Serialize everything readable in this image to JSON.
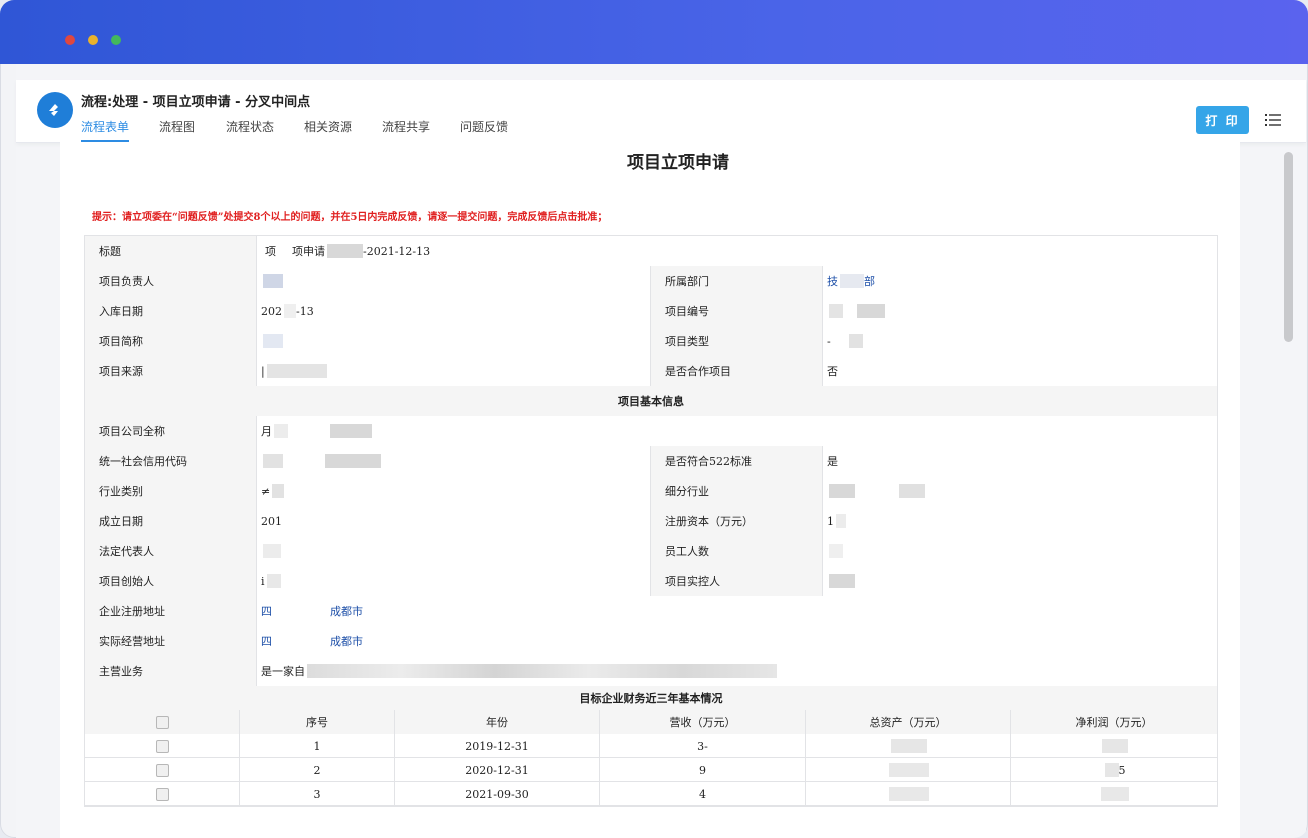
{
  "window": {
    "title": "流程:处理 - 项目立项申请 - 分叉中间点",
    "tabs": [
      "流程表单",
      "流程图",
      "流程状态",
      "相关资源",
      "流程共享",
      "问题反馈"
    ],
    "print_label": "打 印"
  },
  "document": {
    "title": "项目立项申请",
    "hint": "提示：请立项委在“问题反馈”处提交8个以上的问题，并在5日内完成反馈，请逐一提交问题，完成反馈后点击批准；",
    "fields": {
      "title_label": "标题",
      "title_value_a": "项",
      "title_value_b": "项申请",
      "title_value_c": "-2021-12-13",
      "owner_label": "项目负责人",
      "dept_label": "所属部门",
      "dept_value": "技",
      "dept_value_b": "部",
      "date_label": "入库日期",
      "date_value_a": "202",
      "date_value_b": "-13",
      "code_label": "项目编号",
      "short_label": "项目简称",
      "type_label": "项目类型",
      "type_value": "-",
      "source_label": "项目来源",
      "source_value": "|",
      "coop_label": "是否合作项目",
      "coop_value": "否"
    },
    "section_basic": "项目基本信息",
    "basic": {
      "company_label": "项目公司全称",
      "company_value": "月",
      "credit_label": "统一社会信用代码",
      "std_label": "是否符合522标准",
      "std_value": "是",
      "industry_label": "行业类别",
      "industry_value": "≠",
      "sub_industry_label": "细分行业",
      "founded_label": "成立日期",
      "founded_value": "201",
      "capital_label": "注册资本（万元）",
      "capital_value": "1",
      "legal_label": "法定代表人",
      "staff_label": "员工人数",
      "founder_label": "项目创始人",
      "founder_value": "i",
      "controller_label": "项目实控人",
      "reg_addr_label": "企业注册地址",
      "reg_addr_a": "四",
      "reg_addr_b": "成都市",
      "op_addr_label": "实际经营地址",
      "op_addr_a": "四",
      "op_addr_b": "成都市",
      "business_label": "主营业务",
      "business_value": "是一家自"
    },
    "section_finance": "目标企业财务近三年基本情况",
    "finance": {
      "headers": [
        "序号",
        "年份",
        "营收（万元）",
        "总资产（万元）",
        "净利润（万元）"
      ],
      "rows": [
        {
          "no": "1",
          "year": "2019-12-31",
          "revenue": "3-",
          "net": ""
        },
        {
          "no": "2",
          "year": "2020-12-31",
          "revenue": "9",
          "net": "5"
        },
        {
          "no": "3",
          "year": "2021-09-30",
          "revenue": "4",
          "net": ""
        }
      ]
    }
  },
  "colors": {
    "accent": "#2d8ce3",
    "titlebar": "#3f5ce0",
    "hint": "#e02020",
    "print_button": "#35a5e8"
  }
}
